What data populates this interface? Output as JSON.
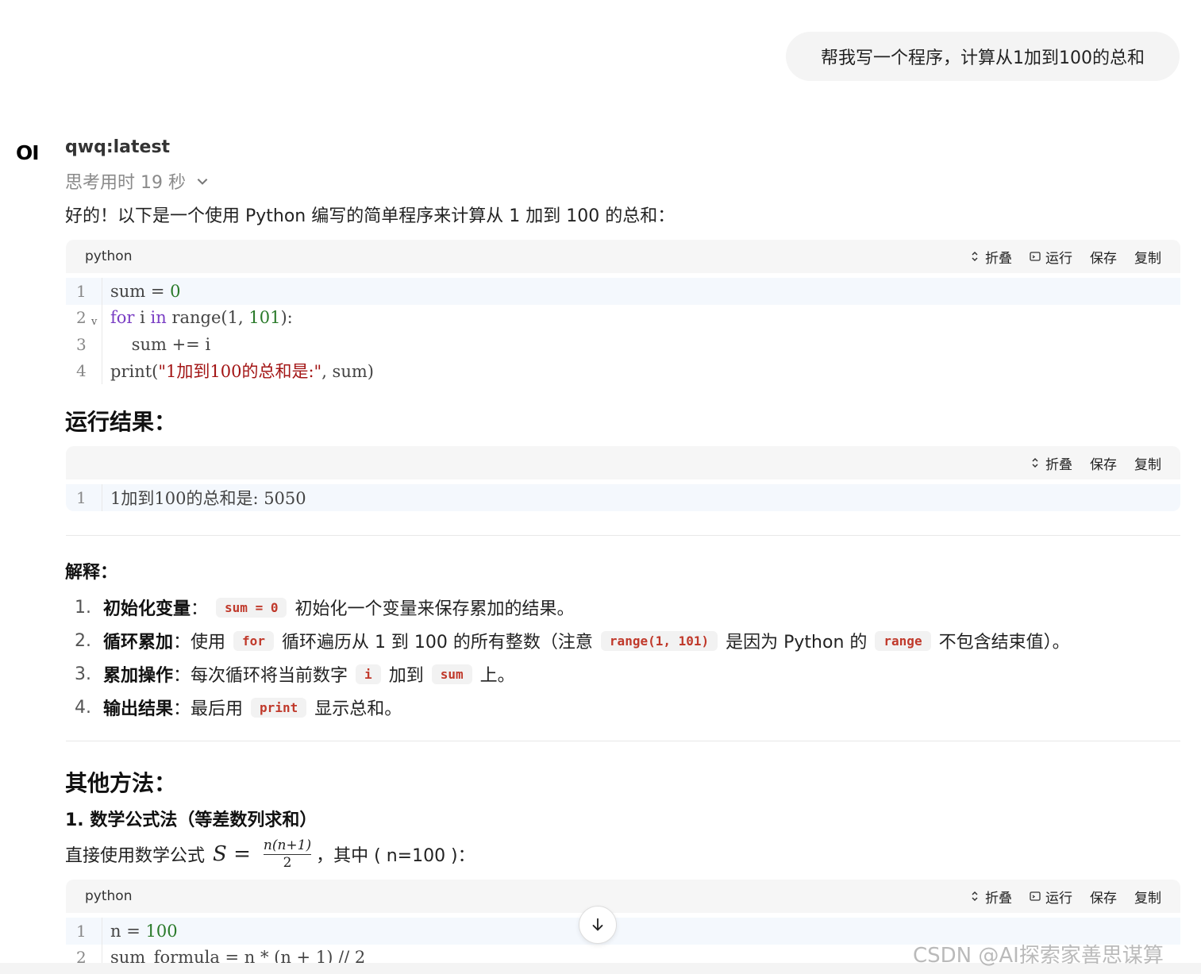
{
  "user_message": "帮我写一个程序，计算从1加到100的总和",
  "assistant": {
    "logo": "OI",
    "model": "qwq:latest",
    "thinking": "思考用时 19 秒",
    "intro": "好的！以下是一个使用 Python 编写的简单程序来计算从 1 加到 100 的总和："
  },
  "code_block_1": {
    "lang": "python",
    "actions": {
      "fold": "折叠",
      "run": "运行",
      "save": "保存",
      "copy": "复制"
    },
    "line_numbers": [
      "1",
      "2",
      "3",
      "4"
    ],
    "lines": {
      "l1_a": "sum = ",
      "l1_b": "0",
      "l2_a": "for",
      "l2_b": " i ",
      "l2_c": "in",
      "l2_d": " range(1, ",
      "l2_e": "101",
      "l2_f": "):",
      "l3": "    sum += i",
      "l4_a": "print(",
      "l4_b": "\"1加到100的总和是:\"",
      "l4_c": ", sum)"
    }
  },
  "result_heading": "运行结果：",
  "code_block_2": {
    "actions": {
      "fold": "折叠",
      "save": "保存",
      "copy": "复制"
    },
    "line_numbers": [
      "1"
    ],
    "line": "1加到100的总和是: 5050"
  },
  "explanation": {
    "heading": "解释：",
    "items": [
      {
        "num": "1.",
        "term": "初始化变量",
        "sep": "：",
        "code": "sum = 0",
        "text": "初始化一个变量来保存累加的结果。"
      },
      {
        "num": "2.",
        "term": "循环累加",
        "sep": "：",
        "pre": "使用",
        "code": "for",
        "mid": "循环遍历从 1 到 100 的所有整数（注意",
        "code2": "range(1, 101)",
        "mid2": "是因为 Python 的",
        "code3": "range",
        "post": "不包含结束值）。"
      },
      {
        "num": "3.",
        "term": "累加操作",
        "sep": "：",
        "pre": "每次循环将当前数字",
        "code": "i",
        "mid": "加到",
        "code2": "sum",
        "post": "上。"
      },
      {
        "num": "4.",
        "term": "输出结果",
        "sep": "：",
        "pre": "最后用",
        "code": "print",
        "post": "显示总和。"
      }
    ]
  },
  "other_methods": {
    "heading": "其他方法：",
    "sub": "1. 数学公式法（等差数列求和）",
    "formula_pre": "直接使用数学公式",
    "formula_s": "S =",
    "formula_num": "n(n+1)",
    "formula_den": "2",
    "formula_post": "，其中 ( n=100 )："
  },
  "code_block_3": {
    "lang": "python",
    "actions": {
      "fold": "折叠",
      "run": "运行",
      "save": "保存",
      "copy": "复制"
    },
    "line_numbers": [
      "1",
      "2"
    ],
    "l1_a": "n = ",
    "l1_b": "100",
    "l2": "sum_formula = n * (n + 1) // 2"
  },
  "watermark": "CSDN @AI探索家善思谋算"
}
